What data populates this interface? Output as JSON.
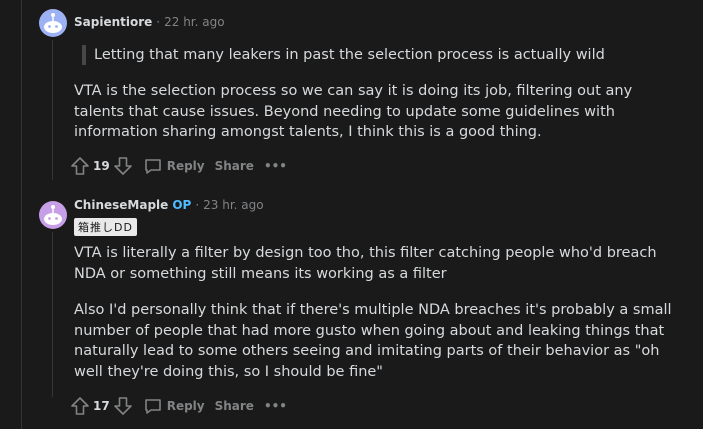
{
  "comments": [
    {
      "username": "Sapientiore",
      "time": "22 hr. ago",
      "quote": "Letting that many leakers in past the selection process is actually wild",
      "paragraphs": [
        "VTA is the selection process so we can say it is doing its job, filtering out any talents that cause issues. Beyond needing to update some guidelines with information sharing amongst talents, I think this is a good thing."
      ],
      "votes": "19",
      "reply_label": "Reply",
      "share_label": "Share",
      "more_label": "•••",
      "avatar_color": "#9db2f5"
    },
    {
      "username": "ChineseMaple",
      "op_label": "OP",
      "time": "23 hr. ago",
      "flair": "箱推しDD",
      "paragraphs": [
        "VTA is literally a filter by design too tho, this filter catching people who'd breach NDA or something still means its working as a filter",
        "Also I'd personally think that if there's multiple NDA breaches it's probably a small number of people that had more gusto when going about and leaking things that naturally lead to some others seeing and imitating parts of their behavior as \"oh well they're doing this, so I should be fine\""
      ],
      "votes": "17",
      "reply_label": "Reply",
      "share_label": "Share",
      "more_label": "•••",
      "avatar_color": "#c79ee8"
    }
  ],
  "separator": "·",
  "colors": {
    "background": "#1a1a1b",
    "text": "#d7dadc",
    "muted": "#818384",
    "op": "#4fbcff"
  }
}
